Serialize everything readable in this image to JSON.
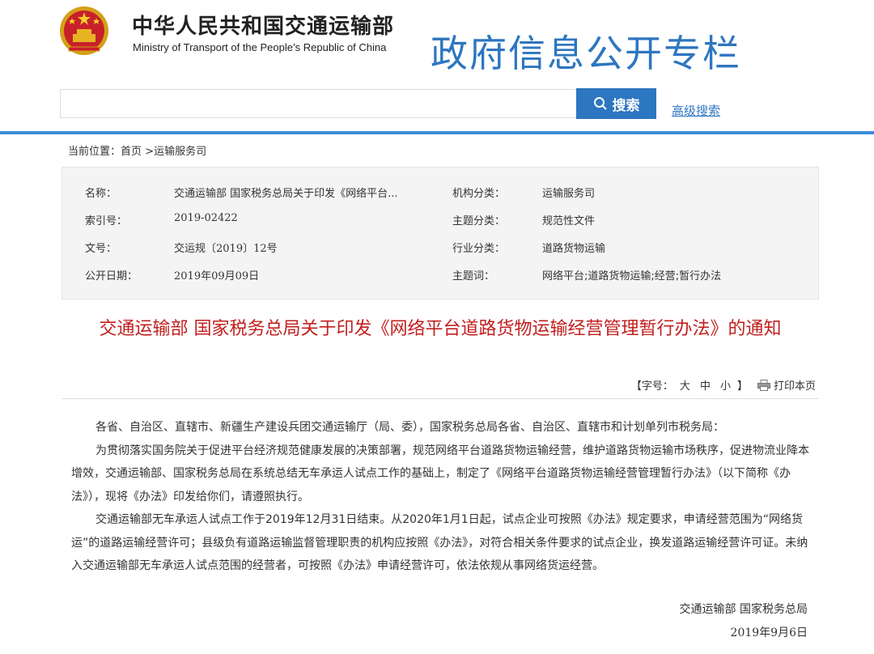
{
  "header": {
    "ministry_cn": "中华人民共和国交通运输部",
    "ministry_en": "Ministry of Transport of the People’s Republic of China",
    "column_title": "政府信息公开专栏",
    "search_placeholder": "",
    "search_button": "搜索",
    "advanced_search": "高级搜索"
  },
  "breadcrumb": {
    "prefix": "当前位置：",
    "home": "首页",
    "separator": " >",
    "current": "运输服务司"
  },
  "info": {
    "rows": [
      {
        "label1": "名称：",
        "value1": "交通运输部 国家税务总局关于印发《网络平台...",
        "label2": "机构分类：",
        "value2": "运输服务司"
      },
      {
        "label1": "索引号：",
        "value1": "2019-02422",
        "label2": "主题分类：",
        "value2": "规范性文件"
      },
      {
        "label1": "文号：",
        "value1": "交运规〔2019〕12号",
        "label2": "行业分类：",
        "value2": "道路货物运输"
      },
      {
        "label1": "公开日期：",
        "value1": "2019年09月09日",
        "label2": "主题词：",
        "value2": "网络平台;道路货物运输;经营;暂行办法"
      }
    ]
  },
  "article": {
    "title": "交通运输部 国家税务总局关于印发《网络平台道路货物运输经营管理暂行办法》的通知",
    "font_label": "【字号：",
    "font_large": "大",
    "font_medium": "中",
    "font_small": "小",
    "font_end": "】",
    "print": "打印本页",
    "paragraphs": [
      "各省、自治区、直辖市、新疆生产建设兵团交通运输厅（局、委），国家税务总局各省、自治区、直辖市和计划单列市税务局：",
      "为贯彻落实国务院关于促进平台经济规范健康发展的决策部署，规范网络平台道路货物运输经营，维护道路货物运输市场秩序，促进物流业降本增效，交通运输部、国家税务总局在系统总结无车承运人试点工作的基础上，制定了《网络平台道路货物运输经营管理暂行办法》（以下简称《办法》），现将《办法》印发给你们，请遵照执行。",
      "交通运输部无车承运人试点工作于2019年12月31日结束。从2020年1月1日起，试点企业可按照《办法》规定要求，申请经营范围为“网络货运”的道路运输经营许可；县级负有道路运输监督管理职责的机构应按照《办法》，对符合相关条件要求的试点企业，换发道路运输经营许可证。未纳入交通运输部无车承运人试点范围的经营者，可按照《办法》申请经营许可，依法依规从事网络货运经营。"
    ],
    "signature": "交通运输部 国家税务总局",
    "date": "2019年9月6日"
  },
  "colors": {
    "brand_blue": "#2d76c0",
    "title_red": "#c0201f",
    "info_bg": "#f4f4f4"
  }
}
